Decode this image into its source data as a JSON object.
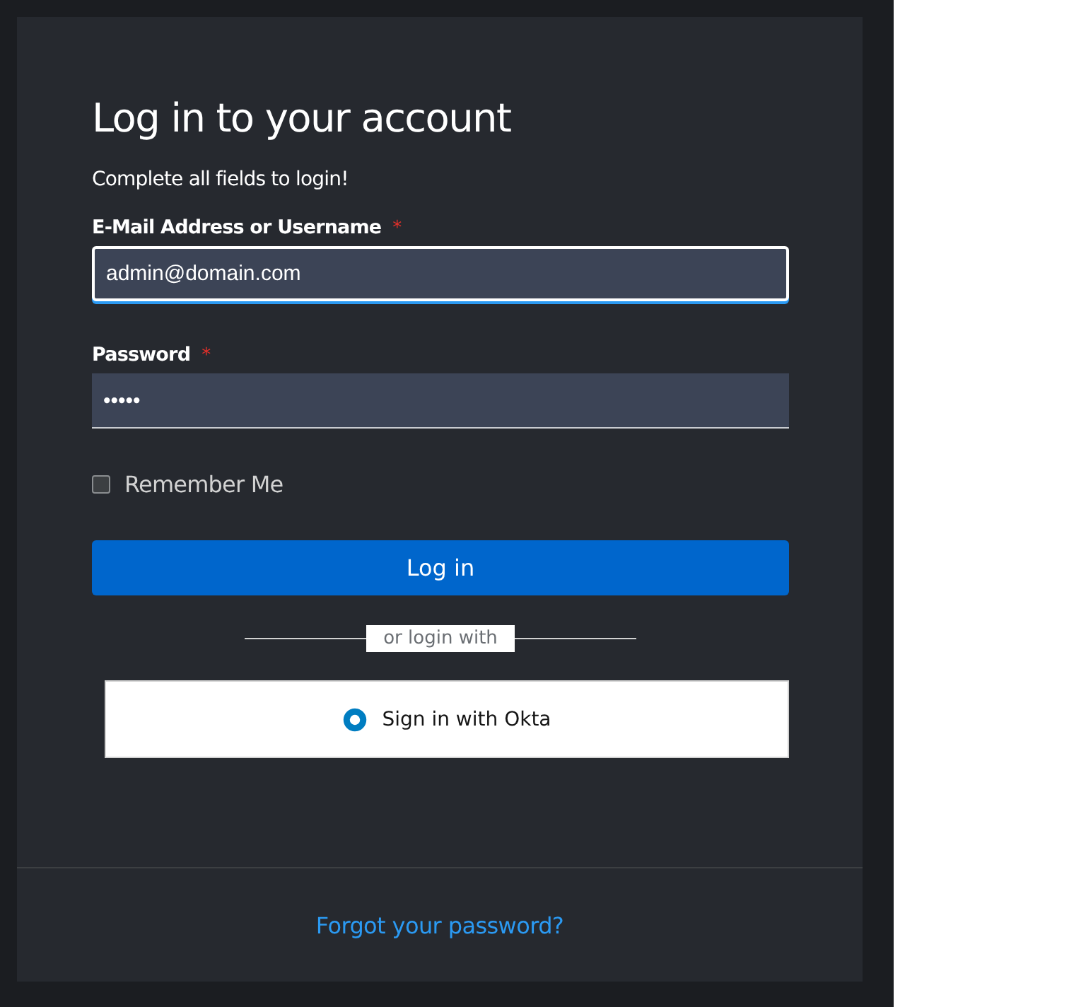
{
  "title": "Log in to your account",
  "subtitle": "Complete all fields to login!",
  "fields": [
    {
      "label": "E-Mail Address or Username",
      "required_mark": "*",
      "value": "admin@domain.com",
      "focused": true
    },
    {
      "label": "Password",
      "required_mark": "*",
      "value": "•••••",
      "focused": false
    }
  ],
  "remember": {
    "label": "Remember Me",
    "checked": false
  },
  "login_button": "Log in",
  "divider_text": "or login with",
  "sso_button": "Sign in with Okta",
  "forgot_link": "Forgot your password?"
}
